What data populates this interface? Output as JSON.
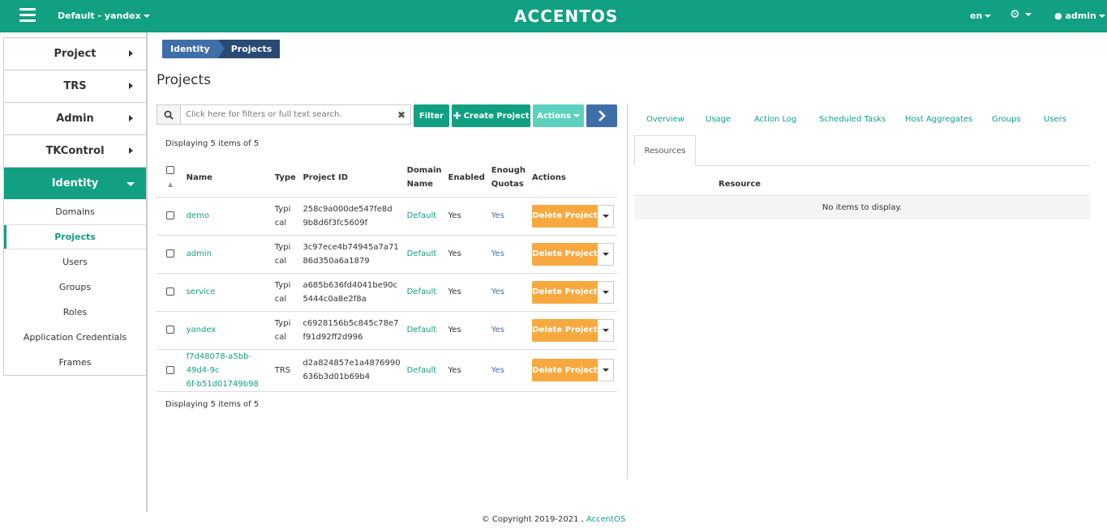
{
  "topbar": {
    "project_selector": "Default - yandex",
    "logo": "ACCENTOS",
    "language": "en",
    "user": "admin",
    "brand_color": "#11a081"
  },
  "sidebar": {
    "items": [
      {
        "label": "Project"
      },
      {
        "label": "TRS"
      },
      {
        "label": "Admin"
      },
      {
        "label": "TKControl"
      },
      {
        "label": "Identity"
      }
    ],
    "subitems": [
      "Domains",
      "Projects",
      "Users",
      "Groups",
      "Roles",
      "Application Credentials",
      "Frames"
    ]
  },
  "breadcrumb": {
    "first": "Identity",
    "second": "Projects"
  },
  "page_title": "Projects",
  "toolbar": {
    "search_placeholder": "Click here for filters or full text search.",
    "filter_label": "Filter",
    "create_label": "Create Project",
    "actions_label": "Actions"
  },
  "table": {
    "displaying_top": "Displaying 5 items of 5",
    "displaying_bottom": "Displaying 5 items of 5",
    "headers": {
      "name": "Name",
      "type": "Type",
      "project_id": "Project ID",
      "domain_name_1": "Domain",
      "domain_name_2": "Name",
      "enabled": "Enabled",
      "quotas_1": "Enough",
      "quotas_2": "Quotas",
      "actions": "Actions"
    },
    "rows": [
      {
        "name_1": "demo",
        "name_2": "",
        "type_1": "Typi",
        "type_2": "cal",
        "id_1": "258c9a000de547fe8d",
        "id_2": "9b8d6f3fc5609f",
        "domain": "Default",
        "enabled": "Yes",
        "quotas": "Yes",
        "action": "Delete Project"
      },
      {
        "name_1": "admin",
        "name_2": "",
        "type_1": "Typi",
        "type_2": "cal",
        "id_1": "3c97ece4b74945a7a71",
        "id_2": "86d350a6a1879",
        "domain": "Default",
        "enabled": "Yes",
        "quotas": "Yes",
        "action": "Delete Project"
      },
      {
        "name_1": "service",
        "name_2": "",
        "type_1": "Typi",
        "type_2": "cal",
        "id_1": "a685b636fd4041be90c",
        "id_2": "5444c0a8e2f8a",
        "domain": "Default",
        "enabled": "Yes",
        "quotas": "Yes",
        "action": "Delete Project"
      },
      {
        "name_1": "yandex",
        "name_2": "",
        "type_1": "Typi",
        "type_2": "cal",
        "id_1": "c6928156b5c845c78e7",
        "id_2": "f91d92ff2d996",
        "domain": "Default",
        "enabled": "Yes",
        "quotas": "Yes",
        "action": "Delete Project"
      },
      {
        "name_1": "f7d48078-a5bb-49d4-9c",
        "name_2": "6f-b51d01749b98",
        "type_1": "TRS",
        "type_2": "",
        "id_1": "d2a824857e1a4876990",
        "id_2": "636b3d01b69b4",
        "domain": "Default",
        "enabled": "Yes",
        "quotas": "Yes",
        "action": "Delete Project"
      }
    ]
  },
  "detail": {
    "tabs": [
      "Overview",
      "Usage",
      "Action Log",
      "Scheduled Tasks",
      "Host Aggregates",
      "Groups",
      "Users"
    ],
    "active_tab": "Resources",
    "resource_header": "Resource",
    "empty_text": "No items to display."
  },
  "footer": {
    "copyright": "© Copyright 2019-2021 ,",
    "brand": "AccentOS"
  }
}
